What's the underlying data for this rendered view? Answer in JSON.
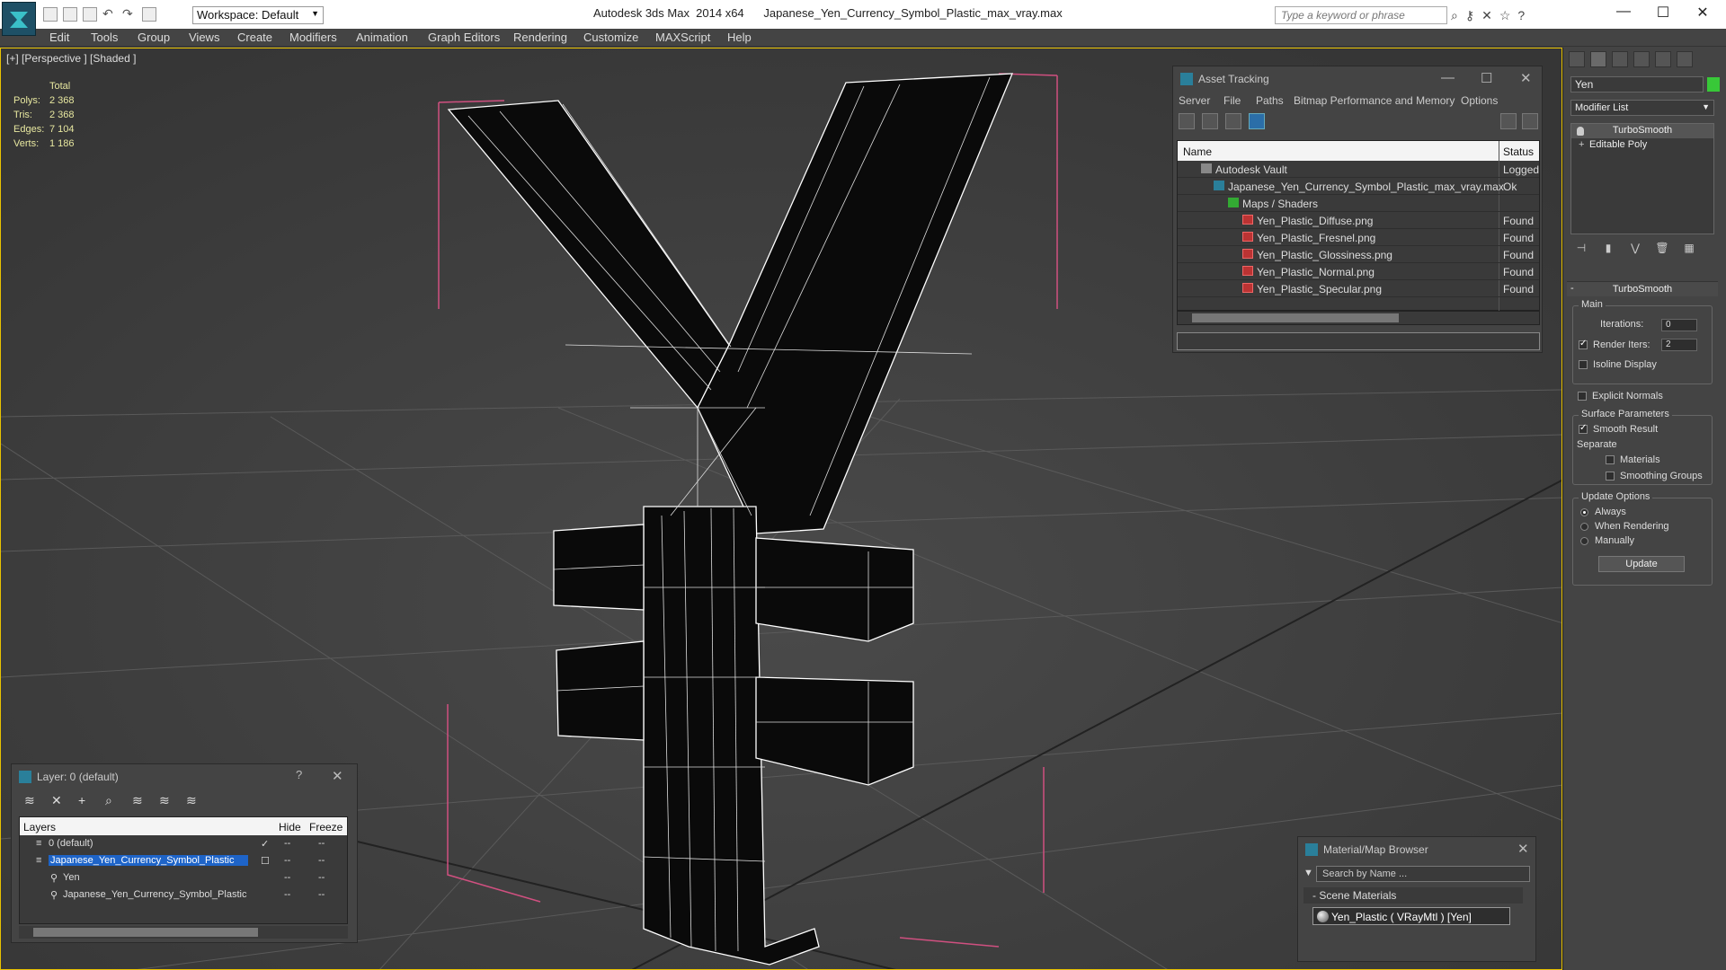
{
  "titlebar": {
    "workspace": "Workspace: Default",
    "app": "Autodesk 3ds Max  2014 x64",
    "file": "Japanese_Yen_Currency_Symbol_Plastic_max_vray.max",
    "search_placeholder": "Type a keyword or phrase"
  },
  "menu": [
    "Edit",
    "Tools",
    "Group",
    "Views",
    "Create",
    "Modifiers",
    "Animation",
    "Graph Editors",
    "Rendering",
    "Customize",
    "MAXScript",
    "Help"
  ],
  "viewport": {
    "label": "[+] [Perspective ] [Shaded ]",
    "stats_header": "Total",
    "stats": [
      {
        "k": "Polys:",
        "v": "2 368"
      },
      {
        "k": "Tris:",
        "v": "2 368"
      },
      {
        "k": "Edges:",
        "v": "7 104"
      },
      {
        "k": "Verts:",
        "v": "1 186"
      }
    ]
  },
  "asset_tracking": {
    "title": "Asset Tracking",
    "menu": [
      "Server",
      "File",
      "Paths",
      "Bitmap Performance and Memory",
      "Options"
    ],
    "col_name": "Name",
    "col_status": "Status",
    "rows": [
      {
        "name": "Autodesk Vault",
        "status": "Logged"
      },
      {
        "name": "Japanese_Yen_Currency_Symbol_Plastic_max_vray.max",
        "status": "Ok"
      },
      {
        "name": "Maps / Shaders",
        "status": ""
      },
      {
        "name": "Yen_Plastic_Diffuse.png",
        "status": "Found"
      },
      {
        "name": "Yen_Plastic_Fresnel.png",
        "status": "Found"
      },
      {
        "name": "Yen_Plastic_Glossiness.png",
        "status": "Found"
      },
      {
        "name": "Yen_Plastic_Normal.png",
        "status": "Found"
      },
      {
        "name": "Yen_Plastic_Specular.png",
        "status": "Found"
      }
    ]
  },
  "layers": {
    "title": "Layer: 0 (default)",
    "col_layers": "Layers",
    "col_hide": "Hide",
    "col_freeze": "Freeze",
    "rows": [
      "0 (default)",
      "Japanese_Yen_Currency_Symbol_Plastic",
      "Yen",
      "Japanese_Yen_Currency_Symbol_Plastic"
    ]
  },
  "material_browser": {
    "title": "Material/Map Browser",
    "search": "Search by Name ...",
    "section": "Scene Materials",
    "item": "Yen_Plastic  ( VRayMtl ) [Yen]"
  },
  "command_panel": {
    "object_name": "Yen",
    "modifier_list": "Modifier List",
    "stack": [
      "TurboSmooth",
      "Editable Poly"
    ],
    "rollout_title": "TurboSmooth",
    "main_label": "Main",
    "iterations_label": "Iterations:",
    "iterations": "0",
    "render_iters_label": "Render Iters:",
    "render_iters": "2",
    "isoline": "Isoline Display",
    "explicit": "Explicit Normals",
    "surface_label": "Surface Parameters",
    "smooth_result": "Smooth Result",
    "separate": "Separate",
    "materials": "Materials",
    "smoothing_groups": "Smoothing Groups",
    "update_label": "Update Options",
    "always": "Always",
    "when_rendering": "When Rendering",
    "manually": "Manually",
    "update_btn": "Update"
  }
}
